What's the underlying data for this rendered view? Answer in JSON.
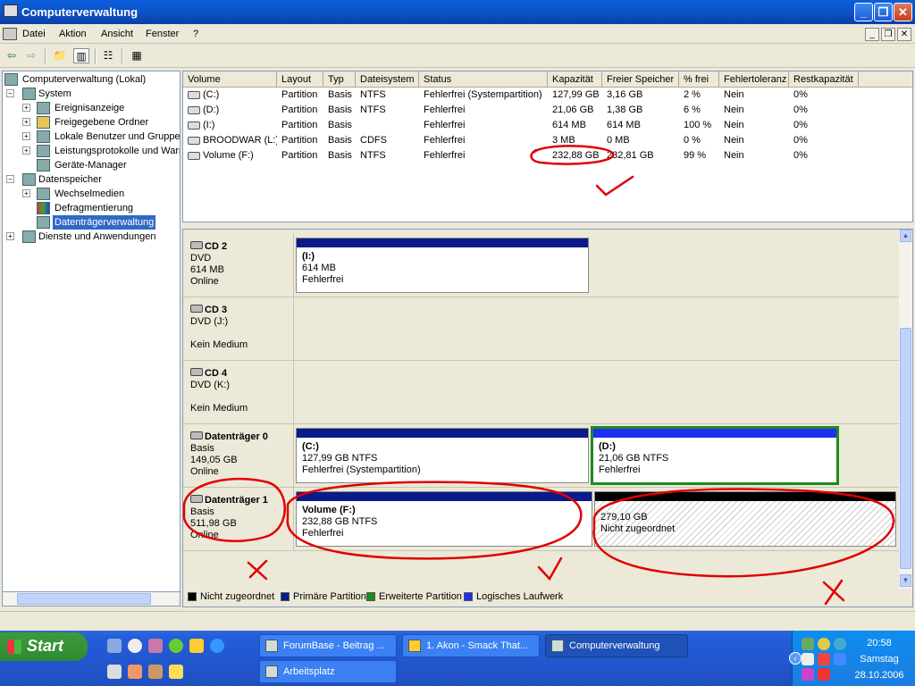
{
  "window": {
    "title": "Computerverwaltung"
  },
  "menu": [
    "Datei",
    "Aktion",
    "Ansicht",
    "Fenster",
    "?"
  ],
  "tree": [
    {
      "label": "Computerverwaltung (Lokal)"
    },
    {
      "label": "System"
    },
    {
      "label": "Ereignisanzeige"
    },
    {
      "label": "Freigegebene Ordner"
    },
    {
      "label": "Lokale Benutzer und Gruppen"
    },
    {
      "label": "Leistungsprotokolle und Warnungen"
    },
    {
      "label": "Geräte-Manager"
    },
    {
      "label": "Datenspeicher"
    },
    {
      "label": "Wechselmedien"
    },
    {
      "label": "Defragmentierung"
    },
    {
      "label": "Datenträgerverwaltung"
    },
    {
      "label": "Dienste und Anwendungen"
    }
  ],
  "columns": [
    "Volume",
    "Layout",
    "Typ",
    "Dateisystem",
    "Status",
    "Kapazität",
    "Freier Speicher",
    "% frei",
    "Fehlertoleranz",
    "Restkapazität"
  ],
  "volumes": [
    {
      "name": "(C:)",
      "layout": "Partition",
      "typ": "Basis",
      "fs": "NTFS",
      "status": "Fehlerfrei (Systempartition)",
      "cap": "127,99 GB",
      "free": "3,16 GB",
      "pct": "2 %",
      "ft": "Nein",
      "rest": "0%"
    },
    {
      "name": "(D:)",
      "layout": "Partition",
      "typ": "Basis",
      "fs": "NTFS",
      "status": "Fehlerfrei",
      "cap": "21,06 GB",
      "free": "1,38 GB",
      "pct": "6 %",
      "ft": "Nein",
      "rest": "0%"
    },
    {
      "name": "(I:)",
      "layout": "Partition",
      "typ": "Basis",
      "fs": "",
      "status": "Fehlerfrei",
      "cap": "614 MB",
      "free": "614 MB",
      "pct": "100 %",
      "ft": "Nein",
      "rest": "0%"
    },
    {
      "name": "BROODWAR (L:)",
      "layout": "Partition",
      "typ": "Basis",
      "fs": "CDFS",
      "status": "Fehlerfrei",
      "cap": "3 MB",
      "free": "0 MB",
      "pct": "0 %",
      "ft": "Nein",
      "rest": "0%"
    },
    {
      "name": "Volume (F:)",
      "layout": "Partition",
      "typ": "Basis",
      "fs": "NTFS",
      "status": "Fehlerfrei",
      "cap": "232,88 GB",
      "free": "232,81 GB",
      "pct": "99 %",
      "ft": "Nein",
      "rest": "0%"
    }
  ],
  "disks": [
    {
      "name": "CD 2",
      "l1": "DVD",
      "l2": "614 MB",
      "l3": "Online",
      "parts": [
        {
          "title": "(I:)",
          "line2": "614 MB",
          "line3": "Fehlerfrei"
        }
      ]
    },
    {
      "name": "CD 3",
      "l1": "DVD (J:)",
      "l2": "",
      "l3": "Kein Medium",
      "parts": []
    },
    {
      "name": "CD 4",
      "l1": "DVD (K:)",
      "l2": "",
      "l3": "Kein Medium",
      "parts": []
    },
    {
      "name": "Datenträger 0",
      "l1": "Basis",
      "l2": "149,05 GB",
      "l3": "Online",
      "parts": [
        {
          "title": "(C:)",
          "line2": "127,99 GB NTFS",
          "line3": "Fehlerfrei (Systempartition)"
        },
        {
          "title": "(D:)",
          "line2": "21,06 GB NTFS",
          "line3": "Fehlerfrei"
        }
      ]
    },
    {
      "name": "Datenträger 1",
      "l1": "Basis",
      "l2": "511,98 GB",
      "l3": "Online",
      "parts": [
        {
          "title": "Volume  (F:)",
          "line2": "232,88 GB NTFS",
          "line3": "Fehlerfrei"
        },
        {
          "title": "",
          "line2": "279,10 GB",
          "line3": "Nicht zugeordnet"
        }
      ]
    }
  ],
  "legend": [
    {
      "label": "Nicht zugeordnet",
      "color": "#000000"
    },
    {
      "label": "Primäre Partition",
      "color": "#0B1A8A"
    },
    {
      "label": "Erweiterte Partition",
      "color": "#1E8A1E"
    },
    {
      "label": "Logisches Laufwerk",
      "color": "#1E2FF0"
    }
  ],
  "taskbar": {
    "start": "Start",
    "tasks": [
      {
        "label": "ForumBase - Beitrag ..."
      },
      {
        "label": "1. Akon - Smack That..."
      },
      {
        "label": "Computerverwaltung"
      },
      {
        "label": "Arbeitsplatz"
      }
    ],
    "clock": {
      "time": "20:58",
      "day": "Samstag",
      "date": "28.10.2006"
    }
  },
  "colors": {
    "primary": "#0B1A8A",
    "logical": "#1E2FF0",
    "extended": "#1E8A1E",
    "unallocated": "#000000",
    "annotation": "#E00000"
  }
}
